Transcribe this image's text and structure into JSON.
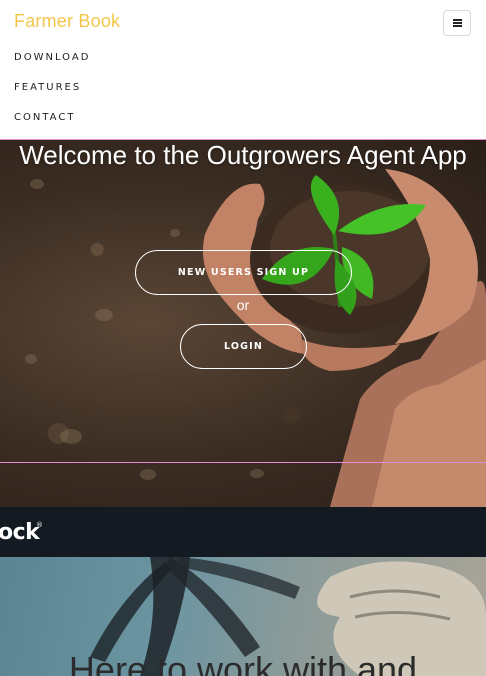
{
  "nav": {
    "brand": "Farmer Book",
    "items": [
      {
        "label": "DOWNLOAD"
      },
      {
        "label": "FEATURES"
      },
      {
        "label": "CONTACT"
      }
    ]
  },
  "hero": {
    "title": "Welcome to the Outgrowers Agent App",
    "signup_label": "NEW USERS SIGN UP",
    "or_label": "or",
    "login_label": "LOGIN"
  },
  "band": {
    "logo_text": "ock"
  },
  "bottom": {
    "heading": "Here to work with and"
  },
  "colors": {
    "brand": "#f3c64a",
    "band": "#141a22",
    "leaf": "#3cb521"
  }
}
